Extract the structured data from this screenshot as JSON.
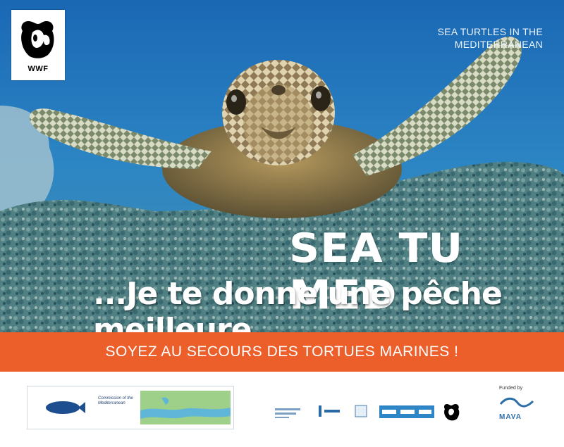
{
  "header": {
    "logo_text": "WWF",
    "project_line1": "SEA TURTLES IN THE",
    "project_line2": "MEDITERRANEAN"
  },
  "campaign": {
    "title": "SEA TU MED",
    "tagline": "...Je te donne une pêche meilleure"
  },
  "banner": {
    "text": "SOYEZ AU SECOURS DES TORTUES MARINES !",
    "color": "#ec5e2a"
  },
  "footer": {
    "partner1_text": "Commission of the Mediterranean",
    "funded_by": "Funded by",
    "mava_label": "MAVA",
    "wwf_small": "WWF"
  },
  "colors": {
    "sea_top": "#1f6fb8",
    "sea_bottom": "#4d8aa0"
  }
}
